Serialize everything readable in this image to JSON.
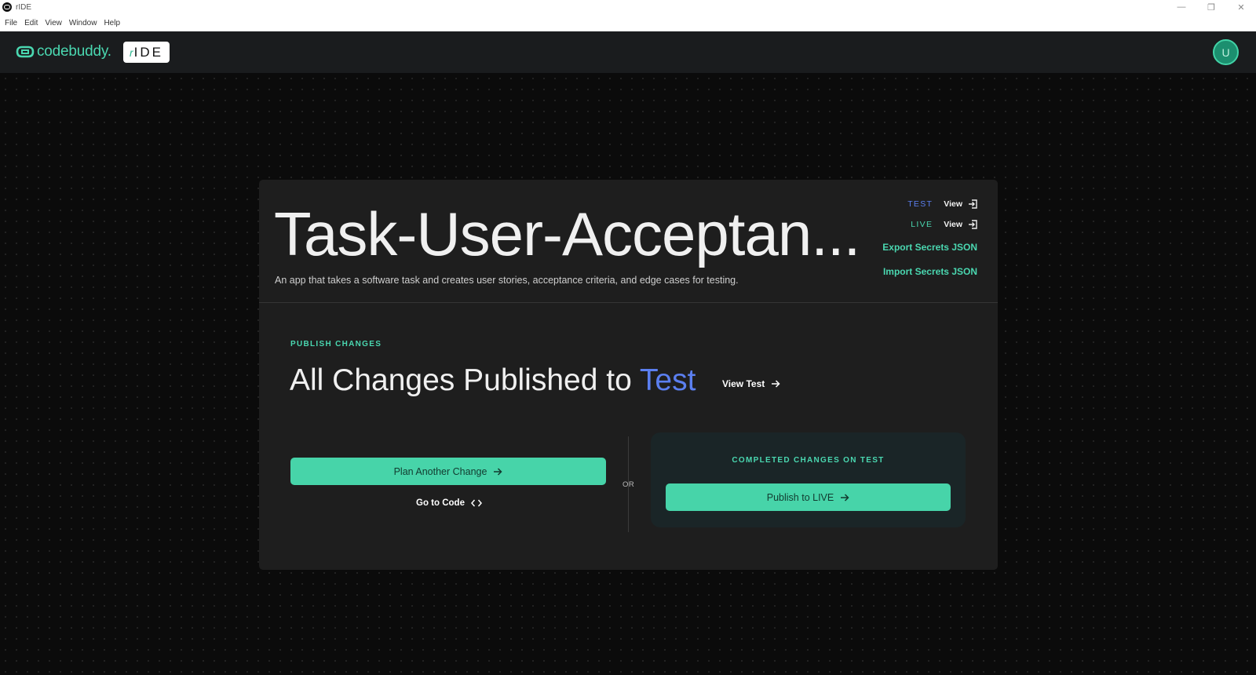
{
  "window": {
    "title": "rIDE",
    "controls": [
      "—",
      "❐",
      "✕"
    ]
  },
  "menu": [
    "File",
    "Edit",
    "View",
    "Window",
    "Help"
  ],
  "header": {
    "brand": "codebuddy.",
    "badge_prefix": "r",
    "badge_text": "IDE",
    "avatar_initial": "U"
  },
  "project": {
    "title": "Task-User-Acceptan...",
    "description": "An app that takes a software task and creates user stories, acceptance criteria, and edge cases for testing."
  },
  "environments": [
    {
      "name": "TEST",
      "link": "View",
      "color": "#5b7ff0"
    },
    {
      "name": "LIVE",
      "link": "View",
      "color": "#4ad7b0"
    }
  ],
  "secrets": {
    "export": "Export Secrets JSON",
    "import": "Import Secrets JSON"
  },
  "publish": {
    "label": "PUBLISH CHANGES",
    "title_main": "All Changes Published to",
    "title_accent": "Test",
    "view_test": "View Test"
  },
  "actions": {
    "plan_another": "Plan Another Change",
    "go_to_code": "Go to Code",
    "or": "OR"
  },
  "completed": {
    "label": "COMPLETED CHANGES ON TEST",
    "publish_live": "Publish to LIVE"
  },
  "colors": {
    "accent_green": "#47d4a9",
    "accent_blue": "#5b7ff0",
    "card_bg": "#1e1e1e"
  }
}
